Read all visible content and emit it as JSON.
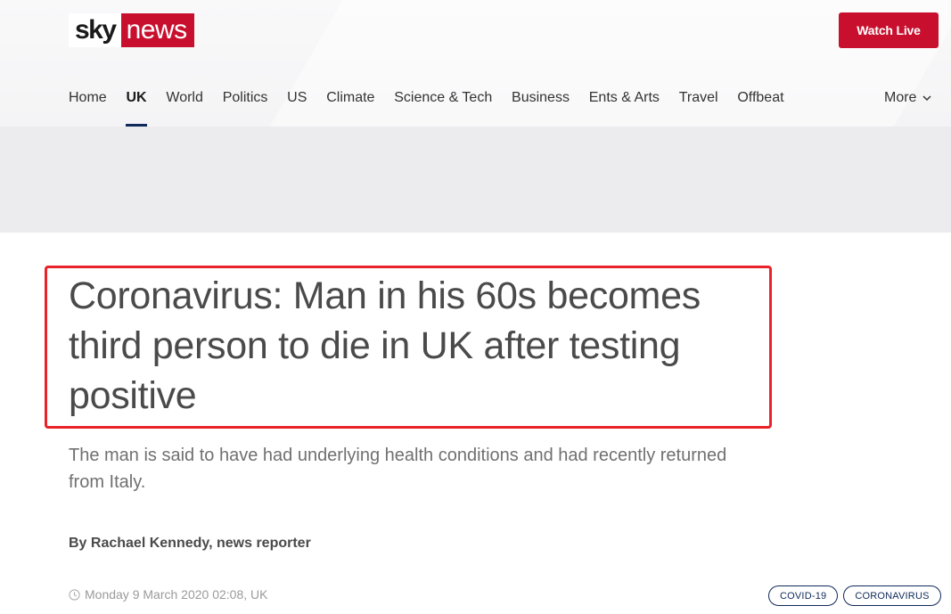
{
  "brand": {
    "logo_sky": "sky",
    "logo_news": "news",
    "accent_red": "#c8102e",
    "nav_underline": "#0f2a5a"
  },
  "header": {
    "watch_live_label": "Watch Live"
  },
  "nav": {
    "items": [
      {
        "label": "Home",
        "active": false
      },
      {
        "label": "UK",
        "active": true
      },
      {
        "label": "World",
        "active": false
      },
      {
        "label": "Politics",
        "active": false
      },
      {
        "label": "US",
        "active": false
      },
      {
        "label": "Climate",
        "active": false
      },
      {
        "label": "Science & Tech",
        "active": false
      },
      {
        "label": "Business",
        "active": false
      },
      {
        "label": "Ents & Arts",
        "active": false
      },
      {
        "label": "Travel",
        "active": false
      },
      {
        "label": "Offbeat",
        "active": false
      }
    ],
    "more_label": "More"
  },
  "article": {
    "headline": "Coronavirus: Man in his 60s becomes third person to die in UK after testing positive",
    "standfirst": "The man is said to have had underlying health conditions and had recently returned from Italy.",
    "byline": "By Rachael Kennedy, news reporter",
    "timestamp": "Monday 9 March 2020 02:08, UK",
    "tags": [
      "COVID-19",
      "CORONAVIRUS"
    ],
    "highlight_color": "#e8232a"
  }
}
